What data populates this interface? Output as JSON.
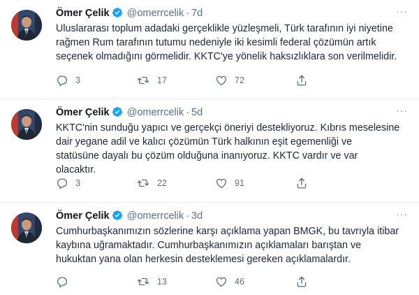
{
  "tweets": [
    {
      "name": "Ömer Çelik",
      "handle": "@omerrcelik",
      "time": "7d",
      "text_lines": [
        "Uluslararası toplum adadaki gerçeklikle yüzleşmeli, Türk tarafının iyi niyetine",
        "rağmen Rum tarafının tutumu nedeniyle iki kesimli federal çözümün artık",
        "seçenek olmadığını görmelidir. KKTC'ye yönelik haksızlıklara son verilmelidir."
      ],
      "replies": "3",
      "retweets": "17",
      "likes": "72"
    },
    {
      "name": "Ömer Çelik",
      "handle": "@omerrcelik",
      "time": "5d",
      "text_lines": [
        "KKTC'nin sunduğu yapıcı ve gerçekçi öneriyi destekliyoruz. Kıbrıs meselesine",
        "dair yegane adil ve kalıcı çözümün Türk halkının eşit egemenliği ve",
        "statüsüne dayalı  bu çözüm olduğuna inanıyoruz. KKTC vardır ve var",
        "olacaktır."
      ],
      "replies": "3",
      "retweets": "22",
      "likes": "91"
    },
    {
      "name": "Ömer Çelik",
      "handle": "@omerrcelik",
      "time": "3d",
      "text_lines": [
        "Cumhurbaşkanımızın sözlerine karşı açıklama yapan BMGK, bu tavrıyla itibar",
        "kaybına uğramaktadır. Cumhurbaşkanımızın açıklamaları barıştan ve",
        "hukuktan yana olan herkesin desteklemesi gereken açıklamalardır."
      ],
      "replies": "",
      "retweets": "13",
      "likes": "46"
    }
  ],
  "colors": {
    "verified": "#1da1f2",
    "muted": "#5b7083",
    "divider": "#e6ecf0"
  },
  "icons": [
    "verified-badge-icon",
    "reply-icon",
    "retweet-icon",
    "like-icon",
    "share-icon",
    "more-icon"
  ]
}
